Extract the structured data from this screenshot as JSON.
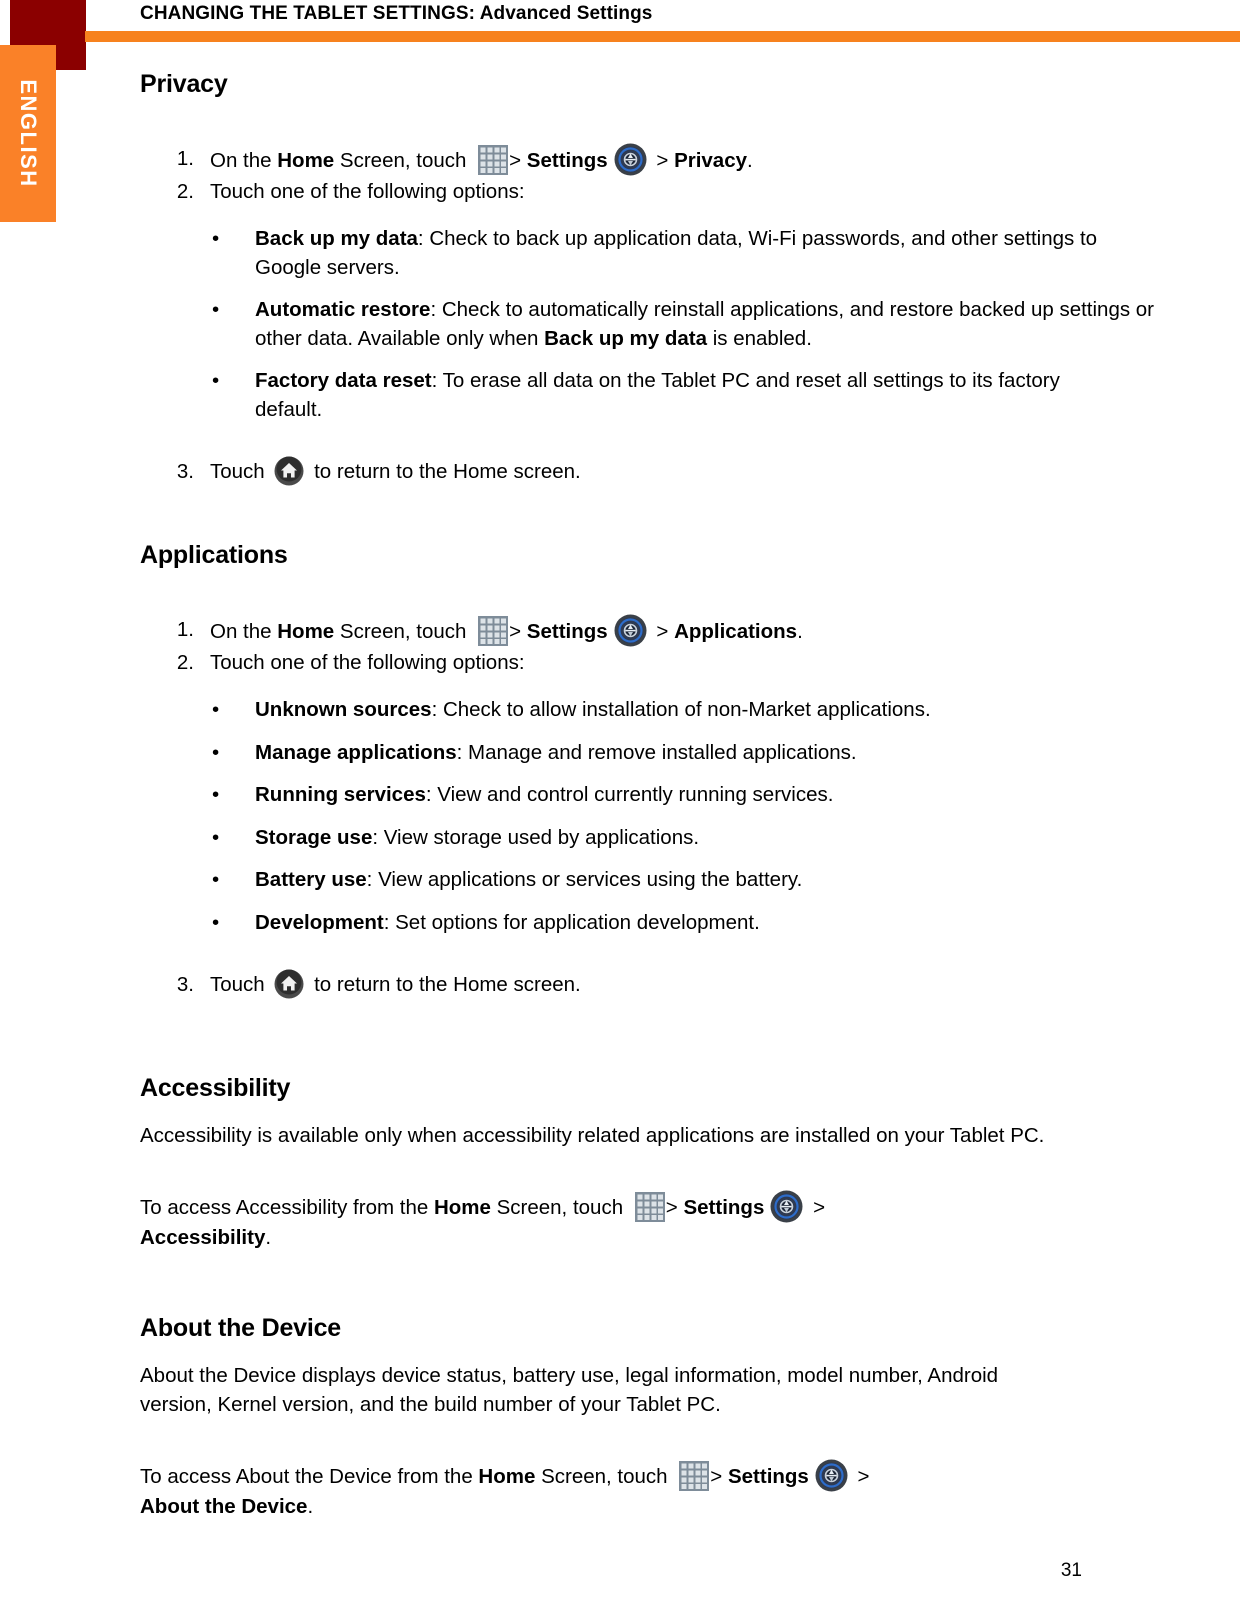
{
  "header": {
    "title": "CHANGING THE TABLET SETTINGS: Advanced Settings",
    "rule_color": "#F7821E",
    "corner_block_color": "#8B0000"
  },
  "language_tab": {
    "label": "ENGLISH",
    "color": "#FA8128"
  },
  "icons": {
    "apps": "apps-grid-icon",
    "settings": "settings-icon",
    "home": "home-icon"
  },
  "sections": [
    {
      "id": "privacy",
      "heading": "Privacy",
      "steps": [
        {
          "num": "1.",
          "parts": {
            "a": "On the ",
            "b_home": "Home",
            "c": " Screen, touch ",
            "gt1": ">",
            "b_settings": "Settings",
            "gt2": ">",
            "b_target": "Privacy",
            "end": "."
          }
        },
        {
          "num": "2.",
          "text": "Touch one of the following options:"
        }
      ],
      "bullets": [
        {
          "term": "Back up my data",
          "rest": ": Check to back up application data, Wi-Fi passwords, and other settings to Google servers."
        },
        {
          "term": "Automatic restore",
          "rest": ": Check to automatically reinstall applications, and restore backed up settings or other data. Available only when ",
          "rest_bold": "Back up my data",
          "rest_tail": " is enabled."
        },
        {
          "term": "Factory data reset",
          "rest": ": To erase all data on the Tablet PC and reset all settings to its factory default."
        }
      ],
      "final_step": {
        "num": "3.",
        "pre": "Touch ",
        "post": " to return to the Home screen."
      }
    },
    {
      "id": "applications",
      "heading": "Applications",
      "steps": [
        {
          "num": "1.",
          "parts": {
            "a": "On the ",
            "b_home": "Home",
            "c": " Screen, touch ",
            "gt1": ">",
            "b_settings": "Settings",
            "gt2": ">",
            "b_target": "Applications",
            "end": "."
          }
        },
        {
          "num": "2.",
          "text": "Touch one of the following options:"
        }
      ],
      "bullets": [
        {
          "term": "Unknown sources",
          "rest": ": Check to allow installation of non-Market applications."
        },
        {
          "term": "Manage applications",
          "rest": ": Manage and remove installed applications."
        },
        {
          "term": "Running services",
          "rest": ": View and control currently running services."
        },
        {
          "term": "Storage use",
          "rest": ": View storage used by applications."
        },
        {
          "term": "Battery use",
          "rest": ": View applications or services using the battery."
        },
        {
          "term": "Development",
          "rest": ": Set options for application development."
        }
      ],
      "final_step": {
        "num": "3.",
        "pre": "Touch ",
        "post": " to return to the Home screen."
      }
    },
    {
      "id": "accessibility",
      "heading": "Accessibility",
      "intro": "Accessibility is available only when accessibility related applications are installed on your Tablet PC.",
      "access_line": {
        "a": "To access Accessibility from the ",
        "b_home": "Home",
        "c": " Screen, touch ",
        "gt1": ">",
        "b_settings": "Settings",
        "gt2": ">",
        "b_target": "Accessibility",
        "end": "."
      }
    },
    {
      "id": "about-the-device",
      "heading": "About the Device",
      "intro": "About the Device displays device status, battery use, legal information, model number, Android version, Kernel version, and the build number of your Tablet PC.",
      "access_line": {
        "a": "To access About the Device from the ",
        "b_home": "Home",
        "c": " Screen, touch ",
        "gt1": ">",
        "b_settings": "Settings",
        "gt2": ">",
        "b_target": "About the Device",
        "end": "."
      }
    }
  ],
  "footer": {
    "page_number": "31"
  }
}
